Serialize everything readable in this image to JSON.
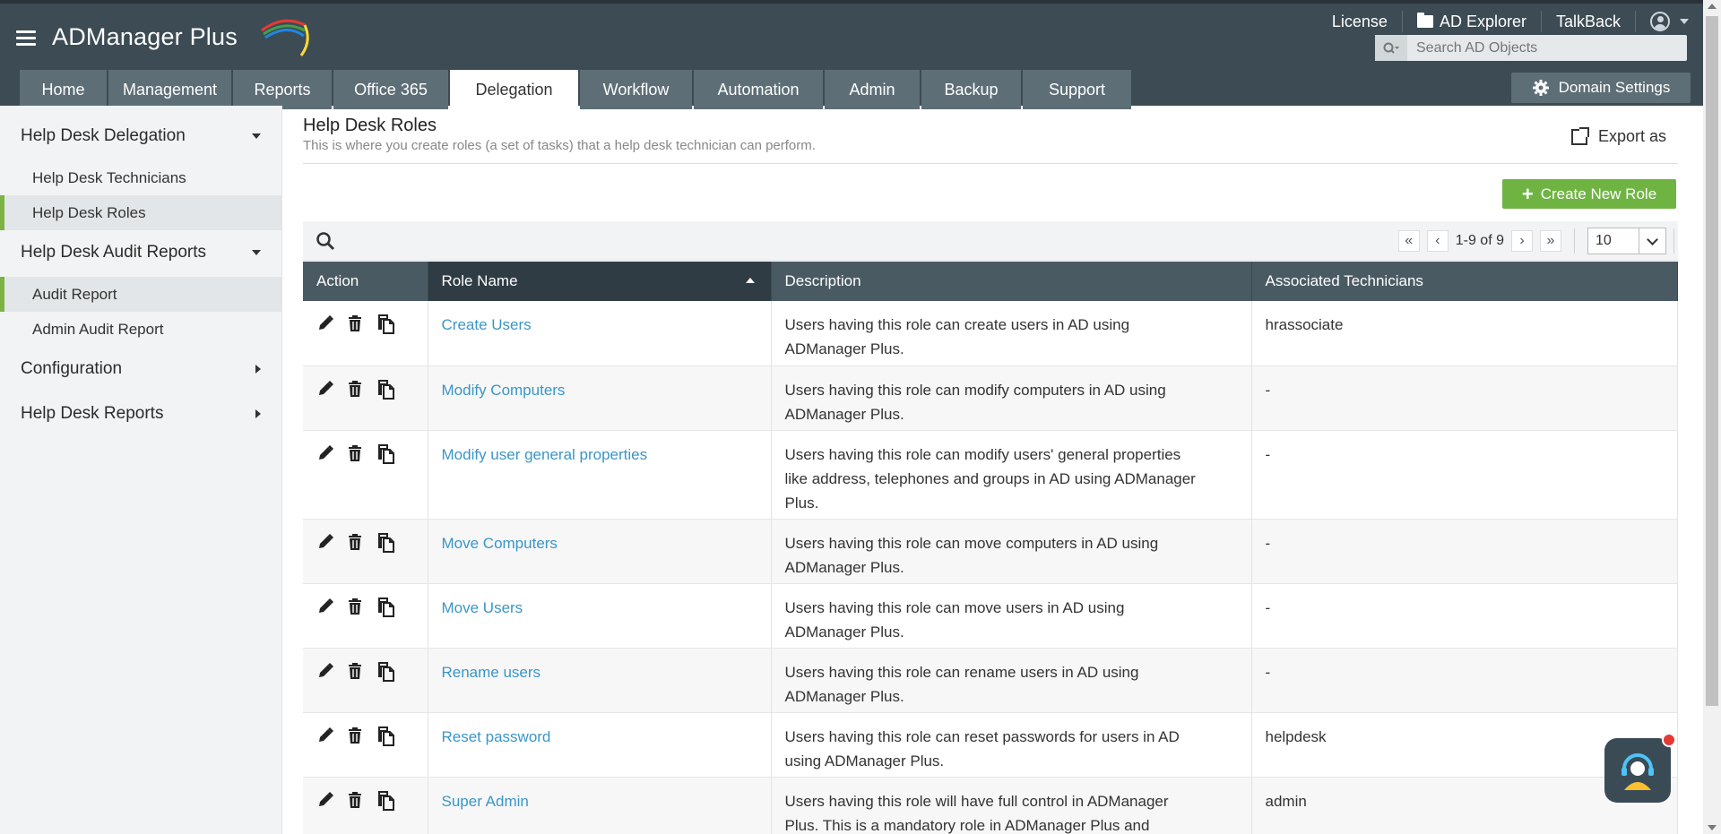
{
  "app": {
    "logo_text": "ADManager Plus",
    "top_links": [
      "License",
      "AD Explorer",
      "TalkBack"
    ],
    "search_placeholder": "Search AD Objects",
    "tabs": [
      {
        "label": "Home",
        "active": false
      },
      {
        "label": "Management",
        "active": false
      },
      {
        "label": "Reports",
        "active": false
      },
      {
        "label": "Office 365",
        "active": false
      },
      {
        "label": "Delegation",
        "active": true
      },
      {
        "label": "Workflow",
        "active": false
      },
      {
        "label": "Automation",
        "active": false
      },
      {
        "label": "Admin",
        "active": false
      },
      {
        "label": "Backup",
        "active": false
      },
      {
        "label": "Support",
        "active": false
      }
    ],
    "domain_settings_label": "Domain Settings"
  },
  "sidebar": {
    "sections": [
      {
        "label": "Help Desk Delegation",
        "expanded": true,
        "items": [
          {
            "label": "Help Desk Technicians",
            "active": false
          },
          {
            "label": "Help Desk Roles",
            "active": true
          }
        ]
      },
      {
        "label": "Help Desk Audit Reports",
        "expanded": true,
        "items": [
          {
            "label": "Audit Report",
            "active": true
          },
          {
            "label": "Admin Audit Report",
            "active": false
          }
        ]
      },
      {
        "label": "Configuration",
        "expanded": false,
        "items": []
      },
      {
        "label": "Help Desk Reports",
        "expanded": false,
        "items": []
      }
    ]
  },
  "main": {
    "title": "Help Desk Roles",
    "subtitle": "This is where you create roles (a set of tasks) that a help desk technician can perform.",
    "export_label": "Export as",
    "create_label": "Create New Role",
    "pager_text": "1-9 of 9",
    "page_size": "10",
    "columns": [
      "Action",
      "Role Name",
      "Description",
      "Associated Technicians"
    ],
    "rows": [
      {
        "role": "Create Users",
        "description": [
          "Users having this role can create users in AD using",
          "ADManager Plus."
        ],
        "technicians": "hrassociate"
      },
      {
        "role": "Modify Computers",
        "description": [
          "Users having this role can modify computers in AD using",
          "ADManager Plus."
        ],
        "technicians": "-"
      },
      {
        "role": "Modify user general properties",
        "description": [
          "Users having this role can modify users' general properties",
          "like address, telephones and groups in AD using ADManager",
          "Plus."
        ],
        "technicians": "-"
      },
      {
        "role": "Move Computers",
        "description": [
          "Users having this role can move computers in AD using",
          "ADManager Plus."
        ],
        "technicians": "-"
      },
      {
        "role": "Move Users",
        "description": [
          "Users having this role can move users in AD using",
          "ADManager Plus."
        ],
        "technicians": "-"
      },
      {
        "role": "Rename users",
        "description": [
          "Users having this role can rename users in AD using",
          "ADManager Plus."
        ],
        "technicians": "-"
      },
      {
        "role": "Reset password",
        "description": [
          "Users having this role can reset passwords for users in AD",
          "using ADManager Plus."
        ],
        "technicians": "helpdesk"
      },
      {
        "role": "Super Admin",
        "description": [
          "Users having this role will have full control in ADManager",
          "Plus. This is a mandatory role in ADManager Plus and"
        ],
        "technicians": "admin"
      }
    ]
  },
  "colors": {
    "header_bg": "#3c4b54",
    "tab_bg": "#5d6e77",
    "accent_green": "#6fb443",
    "link_blue": "#3a96c7"
  }
}
